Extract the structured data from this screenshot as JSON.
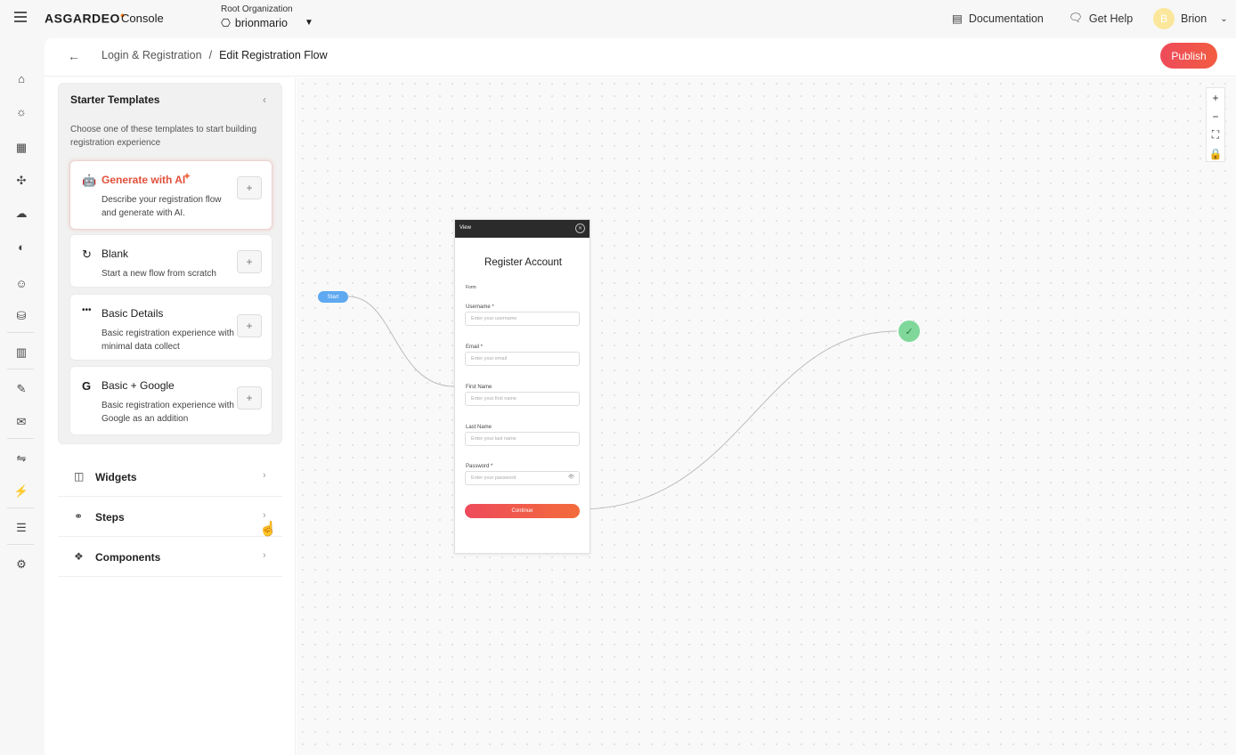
{
  "app": {
    "brand": "ASGARDEO",
    "console": "Console"
  },
  "org": {
    "label": "Root Organization",
    "name": "brionmario"
  },
  "topbar": {
    "documentation": "Documentation",
    "get_help": "Get Help",
    "user_name": "Brion",
    "user_initial": "B"
  },
  "header": {
    "breadcrumb": [
      "Login & Registration",
      "/",
      "Edit Registration Flow"
    ],
    "publish_label": "Publish"
  },
  "templates": {
    "title": "Starter Templates",
    "description": "Choose one of these templates to start building registration experience",
    "items": [
      {
        "title": "Generate with AI",
        "subtitle": "Describe your registration flow and generate with AI.",
        "icon": "ai-robot-icon"
      },
      {
        "title": "Blank",
        "subtitle": "Start a new flow from scratch",
        "icon": "refresh-icon"
      },
      {
        "title": "Basic Details",
        "subtitle": "Basic registration experience with minimal data collect",
        "icon": "dots-icon"
      },
      {
        "title": "Basic + Google",
        "subtitle": "Basic registration experience with Google as an addition",
        "icon": "google-icon"
      }
    ]
  },
  "sections": [
    {
      "label": "Widgets",
      "icon": "widgets-icon"
    },
    {
      "label": "Steps",
      "icon": "steps-icon"
    },
    {
      "label": "Components",
      "icon": "components-icon"
    }
  ],
  "canvas": {
    "start_label": "Start",
    "view": {
      "header": "View",
      "title": "Register Account",
      "form_label": "Form",
      "fields": [
        {
          "label": "Username *",
          "placeholder": "Enter your username"
        },
        {
          "label": "Email *",
          "placeholder": "Enter your email"
        },
        {
          "label": "First Name",
          "placeholder": "Enter your first name"
        },
        {
          "label": "Last Name",
          "placeholder": "Enter your last name"
        },
        {
          "label": "Password *",
          "placeholder": "Enter your password"
        }
      ],
      "button": "Continue"
    }
  },
  "colors": {
    "accent": "#ee4b5b",
    "start_node": "#5ea9f0",
    "end_node": "#7fd89a"
  }
}
